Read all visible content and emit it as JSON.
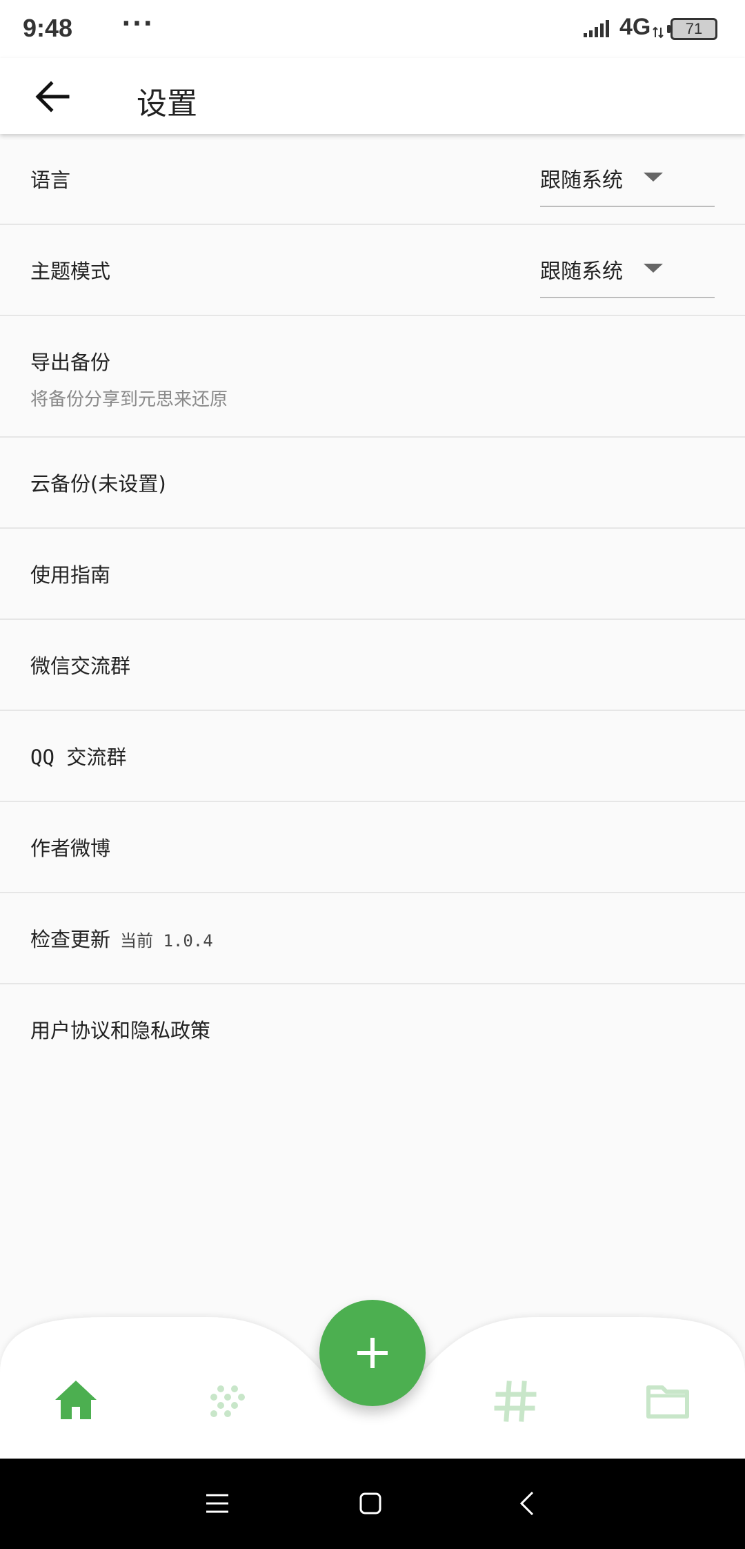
{
  "status_bar": {
    "time": "9:48",
    "dots": "···",
    "network": "4G",
    "battery": "71"
  },
  "app_bar": {
    "title": "设置"
  },
  "settings": {
    "language": {
      "label": "语言",
      "value": "跟随系统"
    },
    "theme": {
      "label": "主题模式",
      "value": "跟随系统"
    },
    "export_backup": {
      "label": "导出备份",
      "subtitle": "将备份分享到元思来还原"
    },
    "cloud_backup": {
      "label": "云备份(未设置)"
    },
    "guide": {
      "label": "使用指南"
    },
    "wechat_group": {
      "label": "微信交流群"
    },
    "qq_group": {
      "label": "QQ 交流群"
    },
    "author_weibo": {
      "label": "作者微博"
    },
    "check_update": {
      "label": "检查更新",
      "current": "当前 1.0.4"
    },
    "agreement": {
      "label": "用户协议和隐私政策"
    }
  },
  "bottom_nav": {
    "items": [
      {
        "icon": "home-icon",
        "active": true
      },
      {
        "icon": "dots-grid-icon",
        "active": false
      },
      {
        "icon": "hashtag-icon",
        "active": false
      },
      {
        "icon": "folder-icon",
        "active": false
      }
    ],
    "fab_icon": "plus-icon"
  },
  "colors": {
    "accent": "#4caf50",
    "accent_light": "#c8e6c9",
    "background": "#fafafa",
    "divider": "#e6e6e6",
    "subtitle": "#8a8a8a"
  }
}
